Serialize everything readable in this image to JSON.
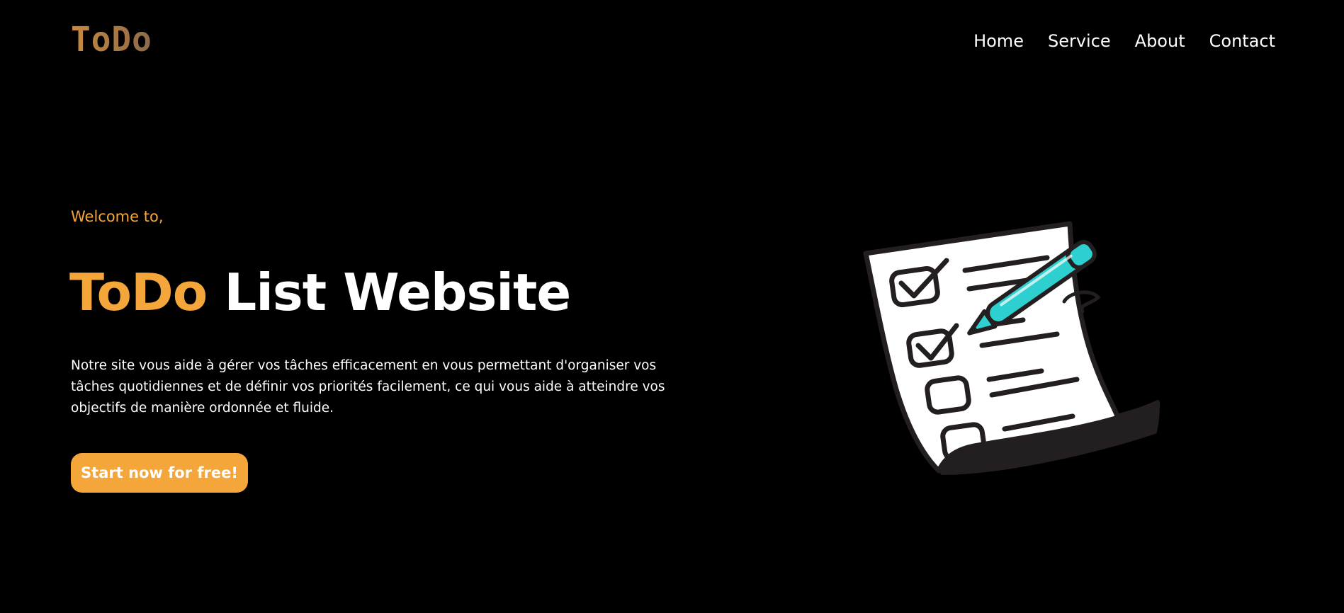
{
  "header": {
    "logo": "ToDo",
    "nav": [
      {
        "label": "Home"
      },
      {
        "label": "Service"
      },
      {
        "label": "About"
      },
      {
        "label": "Contact"
      }
    ]
  },
  "hero": {
    "welcome": "Welcome to,",
    "title_accent": "ToDo",
    "title_rest": " List Website",
    "description": "Notre site vous aide à gérer vos tâches efficacement en vous permettant d'organiser vos tâches quotidiennes et de définir vos priorités facilement, ce qui vous aide à atteindre vos objectifs de manière ordonnée et fluide.",
    "cta_label": "Start now for free!"
  },
  "colors": {
    "background": "#000000",
    "accent": "#f4a63b",
    "text": "#ffffff",
    "pen": "#2ecfcf"
  },
  "illustration": {
    "icon": "checklist-with-pen-icon"
  }
}
